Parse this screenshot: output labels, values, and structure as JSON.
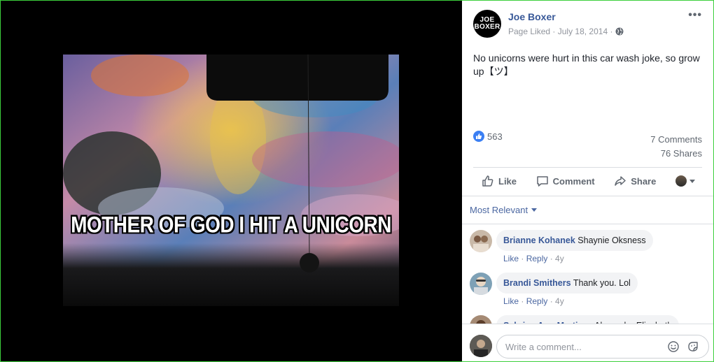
{
  "photo": {
    "caption": "MOTHER OF GOD I HIT A UNICORN"
  },
  "post": {
    "page_avatar_text": [
      "JOE",
      "BOXER"
    ],
    "page_name": "Joe Boxer",
    "liked_label": "Page Liked",
    "date": "July 18, 2014",
    "separator": "·",
    "privacy_icon": "globe-icon",
    "more_icon": "•••",
    "text": "No unicorns were hurt in this car wash joke, so grow up【ツ】"
  },
  "stats": {
    "likes": "563",
    "comments": "7 Comments",
    "shares": "76 Shares"
  },
  "actions": {
    "like": "Like",
    "comment": "Comment",
    "share": "Share"
  },
  "comments_section": {
    "sort_label": "Most Relevant",
    "items": [
      {
        "name": "Brianne Kohanek",
        "text": "Shaynie Oksness",
        "like": "Like",
        "reply": "Reply",
        "age": "4y"
      },
      {
        "name": "Brandi Smithers",
        "text": "Thank you. Lol",
        "like": "Like",
        "reply": "Reply",
        "age": "4y"
      },
      {
        "name": "Sabrina Ann Martinez",
        "text": "Alexandra Elizabeth"
      }
    ]
  },
  "composer": {
    "placeholder": "Write a comment..."
  },
  "colors": {
    "link_blue": "#385898",
    "like_blue": "#3b7ff3",
    "frame_green": "#3ccf3c"
  }
}
